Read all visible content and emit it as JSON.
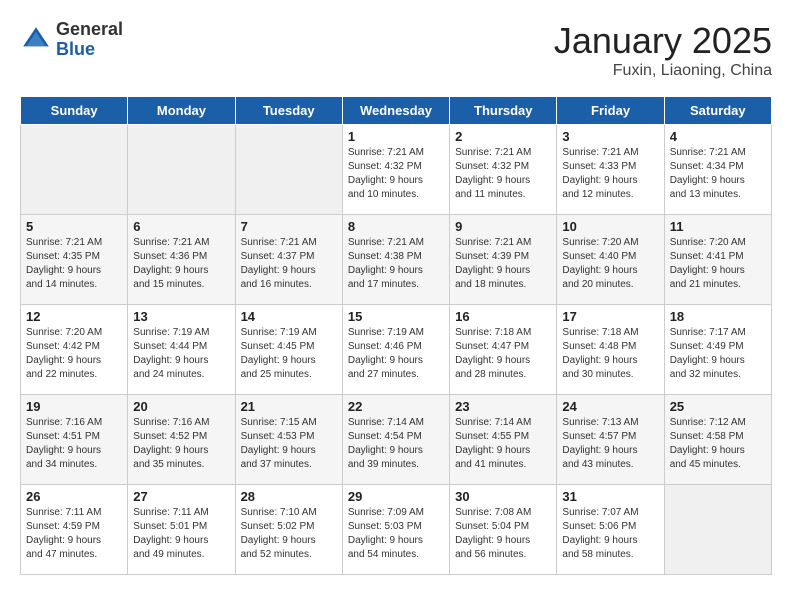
{
  "logo": {
    "general": "General",
    "blue": "Blue"
  },
  "title": "January 2025",
  "location": "Fuxin, Liaoning, China",
  "headers": [
    "Sunday",
    "Monday",
    "Tuesday",
    "Wednesday",
    "Thursday",
    "Friday",
    "Saturday"
  ],
  "weeks": [
    [
      {
        "day": "",
        "info": ""
      },
      {
        "day": "",
        "info": ""
      },
      {
        "day": "",
        "info": ""
      },
      {
        "day": "1",
        "info": "Sunrise: 7:21 AM\nSunset: 4:32 PM\nDaylight: 9 hours\nand 10 minutes."
      },
      {
        "day": "2",
        "info": "Sunrise: 7:21 AM\nSunset: 4:32 PM\nDaylight: 9 hours\nand 11 minutes."
      },
      {
        "day": "3",
        "info": "Sunrise: 7:21 AM\nSunset: 4:33 PM\nDaylight: 9 hours\nand 12 minutes."
      },
      {
        "day": "4",
        "info": "Sunrise: 7:21 AM\nSunset: 4:34 PM\nDaylight: 9 hours\nand 13 minutes."
      }
    ],
    [
      {
        "day": "5",
        "info": "Sunrise: 7:21 AM\nSunset: 4:35 PM\nDaylight: 9 hours\nand 14 minutes."
      },
      {
        "day": "6",
        "info": "Sunrise: 7:21 AM\nSunset: 4:36 PM\nDaylight: 9 hours\nand 15 minutes."
      },
      {
        "day": "7",
        "info": "Sunrise: 7:21 AM\nSunset: 4:37 PM\nDaylight: 9 hours\nand 16 minutes."
      },
      {
        "day": "8",
        "info": "Sunrise: 7:21 AM\nSunset: 4:38 PM\nDaylight: 9 hours\nand 17 minutes."
      },
      {
        "day": "9",
        "info": "Sunrise: 7:21 AM\nSunset: 4:39 PM\nDaylight: 9 hours\nand 18 minutes."
      },
      {
        "day": "10",
        "info": "Sunrise: 7:20 AM\nSunset: 4:40 PM\nDaylight: 9 hours\nand 20 minutes."
      },
      {
        "day": "11",
        "info": "Sunrise: 7:20 AM\nSunset: 4:41 PM\nDaylight: 9 hours\nand 21 minutes."
      }
    ],
    [
      {
        "day": "12",
        "info": "Sunrise: 7:20 AM\nSunset: 4:42 PM\nDaylight: 9 hours\nand 22 minutes."
      },
      {
        "day": "13",
        "info": "Sunrise: 7:19 AM\nSunset: 4:44 PM\nDaylight: 9 hours\nand 24 minutes."
      },
      {
        "day": "14",
        "info": "Sunrise: 7:19 AM\nSunset: 4:45 PM\nDaylight: 9 hours\nand 25 minutes."
      },
      {
        "day": "15",
        "info": "Sunrise: 7:19 AM\nSunset: 4:46 PM\nDaylight: 9 hours\nand 27 minutes."
      },
      {
        "day": "16",
        "info": "Sunrise: 7:18 AM\nSunset: 4:47 PM\nDaylight: 9 hours\nand 28 minutes."
      },
      {
        "day": "17",
        "info": "Sunrise: 7:18 AM\nSunset: 4:48 PM\nDaylight: 9 hours\nand 30 minutes."
      },
      {
        "day": "18",
        "info": "Sunrise: 7:17 AM\nSunset: 4:49 PM\nDaylight: 9 hours\nand 32 minutes."
      }
    ],
    [
      {
        "day": "19",
        "info": "Sunrise: 7:16 AM\nSunset: 4:51 PM\nDaylight: 9 hours\nand 34 minutes."
      },
      {
        "day": "20",
        "info": "Sunrise: 7:16 AM\nSunset: 4:52 PM\nDaylight: 9 hours\nand 35 minutes."
      },
      {
        "day": "21",
        "info": "Sunrise: 7:15 AM\nSunset: 4:53 PM\nDaylight: 9 hours\nand 37 minutes."
      },
      {
        "day": "22",
        "info": "Sunrise: 7:14 AM\nSunset: 4:54 PM\nDaylight: 9 hours\nand 39 minutes."
      },
      {
        "day": "23",
        "info": "Sunrise: 7:14 AM\nSunset: 4:55 PM\nDaylight: 9 hours\nand 41 minutes."
      },
      {
        "day": "24",
        "info": "Sunrise: 7:13 AM\nSunset: 4:57 PM\nDaylight: 9 hours\nand 43 minutes."
      },
      {
        "day": "25",
        "info": "Sunrise: 7:12 AM\nSunset: 4:58 PM\nDaylight: 9 hours\nand 45 minutes."
      }
    ],
    [
      {
        "day": "26",
        "info": "Sunrise: 7:11 AM\nSunset: 4:59 PM\nDaylight: 9 hours\nand 47 minutes."
      },
      {
        "day": "27",
        "info": "Sunrise: 7:11 AM\nSunset: 5:01 PM\nDaylight: 9 hours\nand 49 minutes."
      },
      {
        "day": "28",
        "info": "Sunrise: 7:10 AM\nSunset: 5:02 PM\nDaylight: 9 hours\nand 52 minutes."
      },
      {
        "day": "29",
        "info": "Sunrise: 7:09 AM\nSunset: 5:03 PM\nDaylight: 9 hours\nand 54 minutes."
      },
      {
        "day": "30",
        "info": "Sunrise: 7:08 AM\nSunset: 5:04 PM\nDaylight: 9 hours\nand 56 minutes."
      },
      {
        "day": "31",
        "info": "Sunrise: 7:07 AM\nSunset: 5:06 PM\nDaylight: 9 hours\nand 58 minutes."
      },
      {
        "day": "",
        "info": ""
      }
    ]
  ]
}
